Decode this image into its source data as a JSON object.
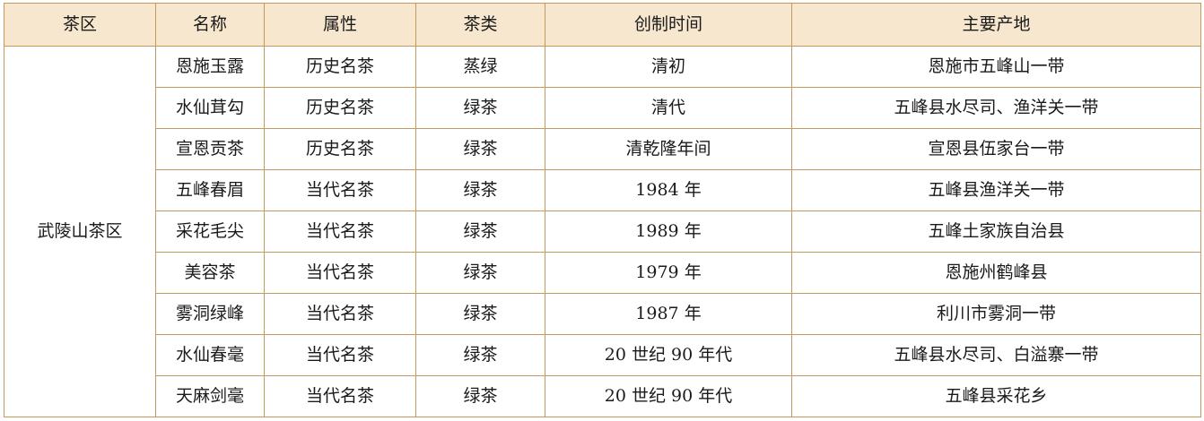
{
  "table": {
    "headers": [
      "茶区",
      "名称",
      "属性",
      "茶类",
      "创制时间",
      "主要产地"
    ],
    "region": "武陵山茶区",
    "rows": [
      {
        "name": "恩施玉露",
        "attribute": "历史名茶",
        "category": "蒸绿",
        "created": "清初",
        "origin": "恩施市五峰山一带"
      },
      {
        "name": "水仙茸勾",
        "attribute": "历史名茶",
        "category": "绿茶",
        "created": "清代",
        "origin": "五峰县水尽司、渔洋关一带"
      },
      {
        "name": "宣恩贡茶",
        "attribute": "历史名茶",
        "category": "绿茶",
        "created": "清乾隆年间",
        "origin": "宣恩县伍家台一带"
      },
      {
        "name": "五峰春眉",
        "attribute": "当代名茶",
        "category": "绿茶",
        "created": "1984 年",
        "origin": "五峰县渔洋关一带"
      },
      {
        "name": "采花毛尖",
        "attribute": "当代名茶",
        "category": "绿茶",
        "created": "1989 年",
        "origin": "五峰土家族自治县"
      },
      {
        "name": "美容茶",
        "attribute": "当代名茶",
        "category": "绿茶",
        "created": "1979 年",
        "origin": "恩施州鹤峰县"
      },
      {
        "name": "雾洞绿峰",
        "attribute": "当代名茶",
        "category": "绿茶",
        "created": "1987 年",
        "origin": "利川市雾洞一带"
      },
      {
        "name": "水仙春毫",
        "attribute": "当代名茶",
        "category": "绿茶",
        "created": "20 世纪 90 年代",
        "origin": "五峰县水尽司、白溢寨一带"
      },
      {
        "name": "天麻剑毫",
        "attribute": "当代名茶",
        "category": "绿茶",
        "created": "20 世纪 90 年代",
        "origin": "五峰县采花乡"
      }
    ]
  },
  "colors": {
    "header_background": "#f7e7ce",
    "border": "#c49a5c",
    "text": "#1a1a1a"
  }
}
